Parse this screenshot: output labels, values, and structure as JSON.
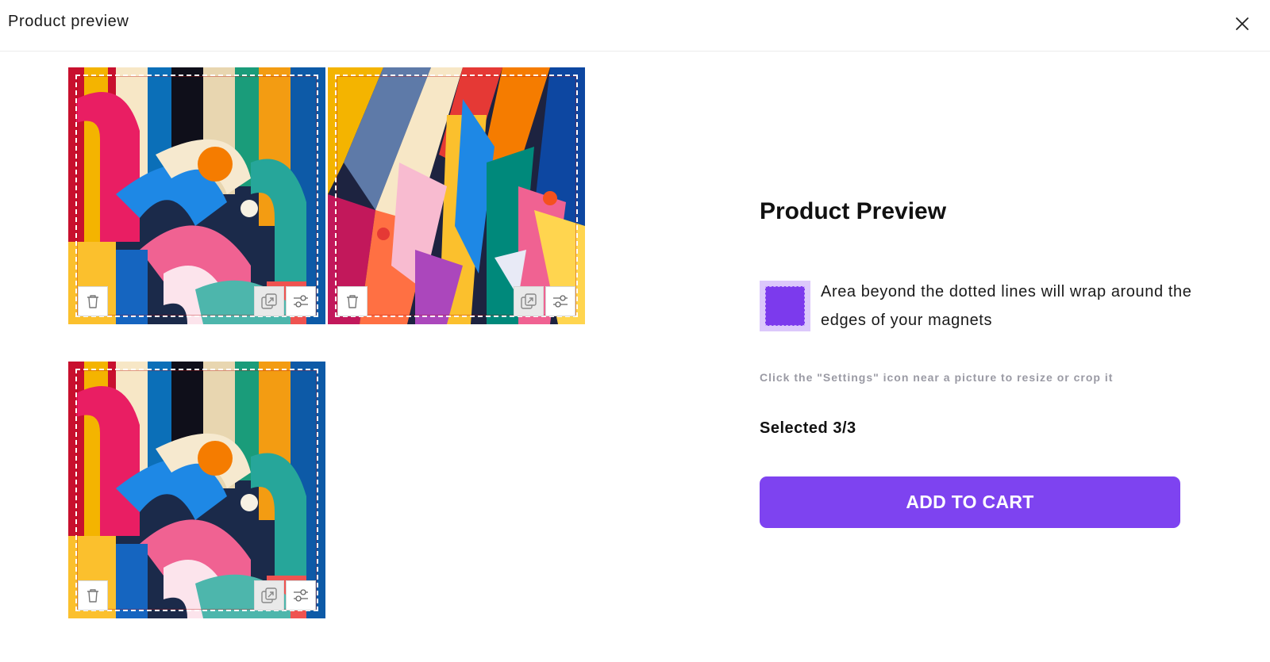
{
  "header": {
    "title": "Product preview",
    "close_icon": "close-icon"
  },
  "tiles": [
    {
      "artwork": "abstract-curves",
      "icons": [
        "trash-icon",
        "swap-image-icon",
        "sliders-settings-icon"
      ]
    },
    {
      "artwork": "abstract-geometric",
      "icons": [
        "trash-icon",
        "swap-image-icon",
        "sliders-settings-icon"
      ]
    },
    {
      "artwork": "abstract-curves",
      "icons": [
        "trash-icon",
        "swap-image-icon",
        "sliders-settings-icon"
      ]
    }
  ],
  "panel": {
    "title": "Product Preview",
    "wrap_note": "Area beyond the dotted lines will wrap around the edges of your magnets",
    "hint": "Click the \"Settings\" icon near a picture to resize or crop it",
    "selected": "Selected 3/3",
    "add_to_cart": "ADD TO CART"
  },
  "colors": {
    "accent": "#7e43f0",
    "swatch_outer": "#dcc8fb",
    "swatch_inner": "#7c3aed",
    "hint_text": "#9a9aa4"
  }
}
